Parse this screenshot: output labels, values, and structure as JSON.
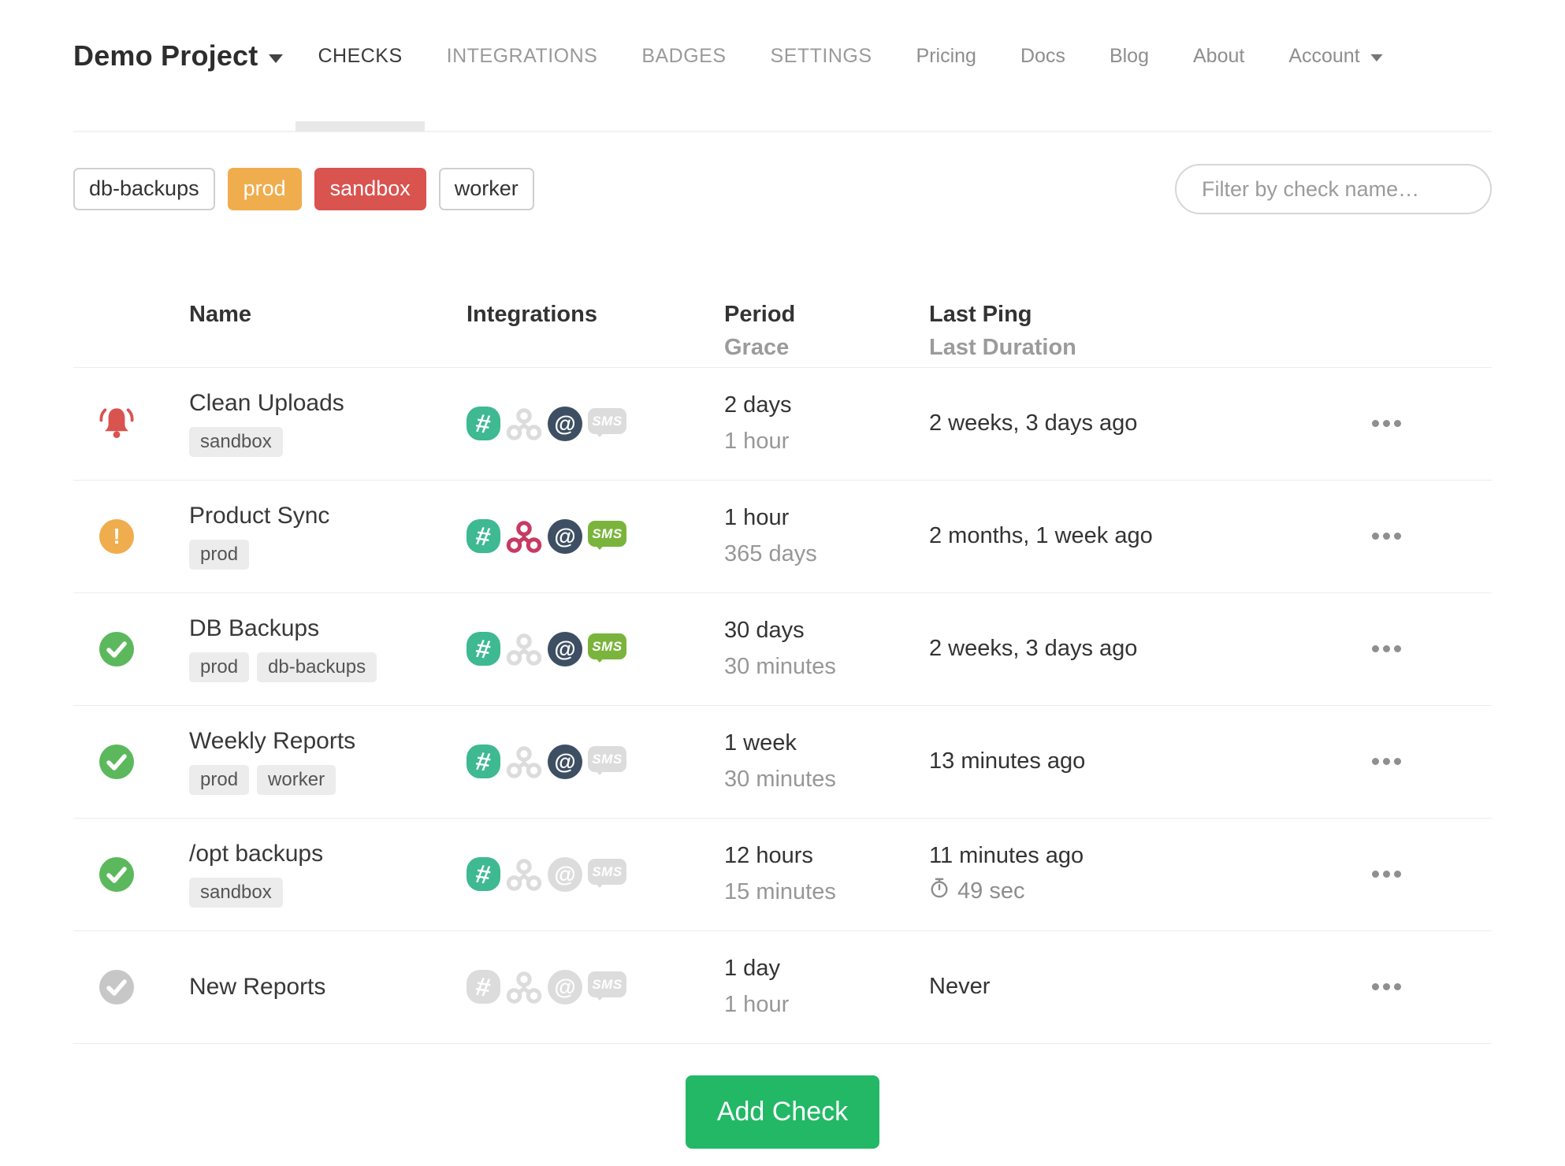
{
  "nav": {
    "project_name": "Demo Project",
    "tabs": [
      {
        "label": "CHECKS",
        "active": true
      },
      {
        "label": "INTEGRATIONS",
        "active": false
      },
      {
        "label": "BADGES",
        "active": false
      },
      {
        "label": "SETTINGS",
        "active": false
      }
    ],
    "links": [
      "Pricing",
      "Docs",
      "Blog",
      "About"
    ],
    "account_label": "Account"
  },
  "filters": {
    "tags": [
      {
        "label": "db-backups",
        "variant": "default"
      },
      {
        "label": "prod",
        "variant": "warning"
      },
      {
        "label": "sandbox",
        "variant": "danger"
      },
      {
        "label": "worker",
        "variant": "default"
      }
    ],
    "search_placeholder": "Filter by check name…"
  },
  "glyphs": {
    "slack": "#",
    "email": "@",
    "sms": "SMS",
    "warning": "!"
  },
  "table": {
    "headers": {
      "name": "Name",
      "integrations": "Integrations",
      "period": "Period",
      "grace": "Grace",
      "last_ping": "Last Ping",
      "last_duration": "Last Duration"
    },
    "rows": [
      {
        "status": "down",
        "name": "Clean Uploads",
        "tags": [
          "sandbox"
        ],
        "integrations": {
          "slack": true,
          "webhook": false,
          "email": true,
          "sms": false
        },
        "period": "2 days",
        "grace": "1 hour",
        "last_ping": "2 weeks, 3 days ago",
        "last_duration": null
      },
      {
        "status": "late",
        "name": "Product Sync",
        "tags": [
          "prod"
        ],
        "integrations": {
          "slack": true,
          "webhook": true,
          "email": true,
          "sms": true
        },
        "period": "1 hour",
        "grace": "365 days",
        "last_ping": "2 months, 1 week ago",
        "last_duration": null
      },
      {
        "status": "up",
        "name": "DB Backups",
        "tags": [
          "prod",
          "db-backups"
        ],
        "integrations": {
          "slack": true,
          "webhook": false,
          "email": true,
          "sms": true
        },
        "period": "30 days",
        "grace": "30 minutes",
        "last_ping": "2 weeks, 3 days ago",
        "last_duration": null
      },
      {
        "status": "up",
        "name": "Weekly Reports",
        "tags": [
          "prod",
          "worker"
        ],
        "integrations": {
          "slack": true,
          "webhook": false,
          "email": true,
          "sms": false
        },
        "period": "1 week",
        "grace": "30 minutes",
        "last_ping": "13 minutes ago",
        "last_duration": null
      },
      {
        "status": "up",
        "name": "/opt backups",
        "tags": [
          "sandbox"
        ],
        "integrations": {
          "slack": true,
          "webhook": false,
          "email": false,
          "sms": false
        },
        "period": "12 hours",
        "grace": "15 minutes",
        "last_ping": "11 minutes ago",
        "last_duration": "49 sec"
      },
      {
        "status": "new",
        "name": "New Reports",
        "tags": [],
        "integrations": {
          "slack": false,
          "webhook": false,
          "email": false,
          "sms": false
        },
        "period": "1 day",
        "grace": "1 hour",
        "last_ping": "Never",
        "last_duration": null
      }
    ]
  },
  "add_check": {
    "label": "Add Check"
  },
  "colors": {
    "accent_up": "#5cb85c",
    "accent_late": "#f0ad4e",
    "accent_down": "#d9534f",
    "slack": "#3eb991",
    "webhook": "#c73a63",
    "email": "#3e4f63",
    "sms": "#7ab43c",
    "muted": "#dcdcdc",
    "muted_dark": "#c7c7c7",
    "chip_bg": "#ececec",
    "button": "#22b866"
  }
}
